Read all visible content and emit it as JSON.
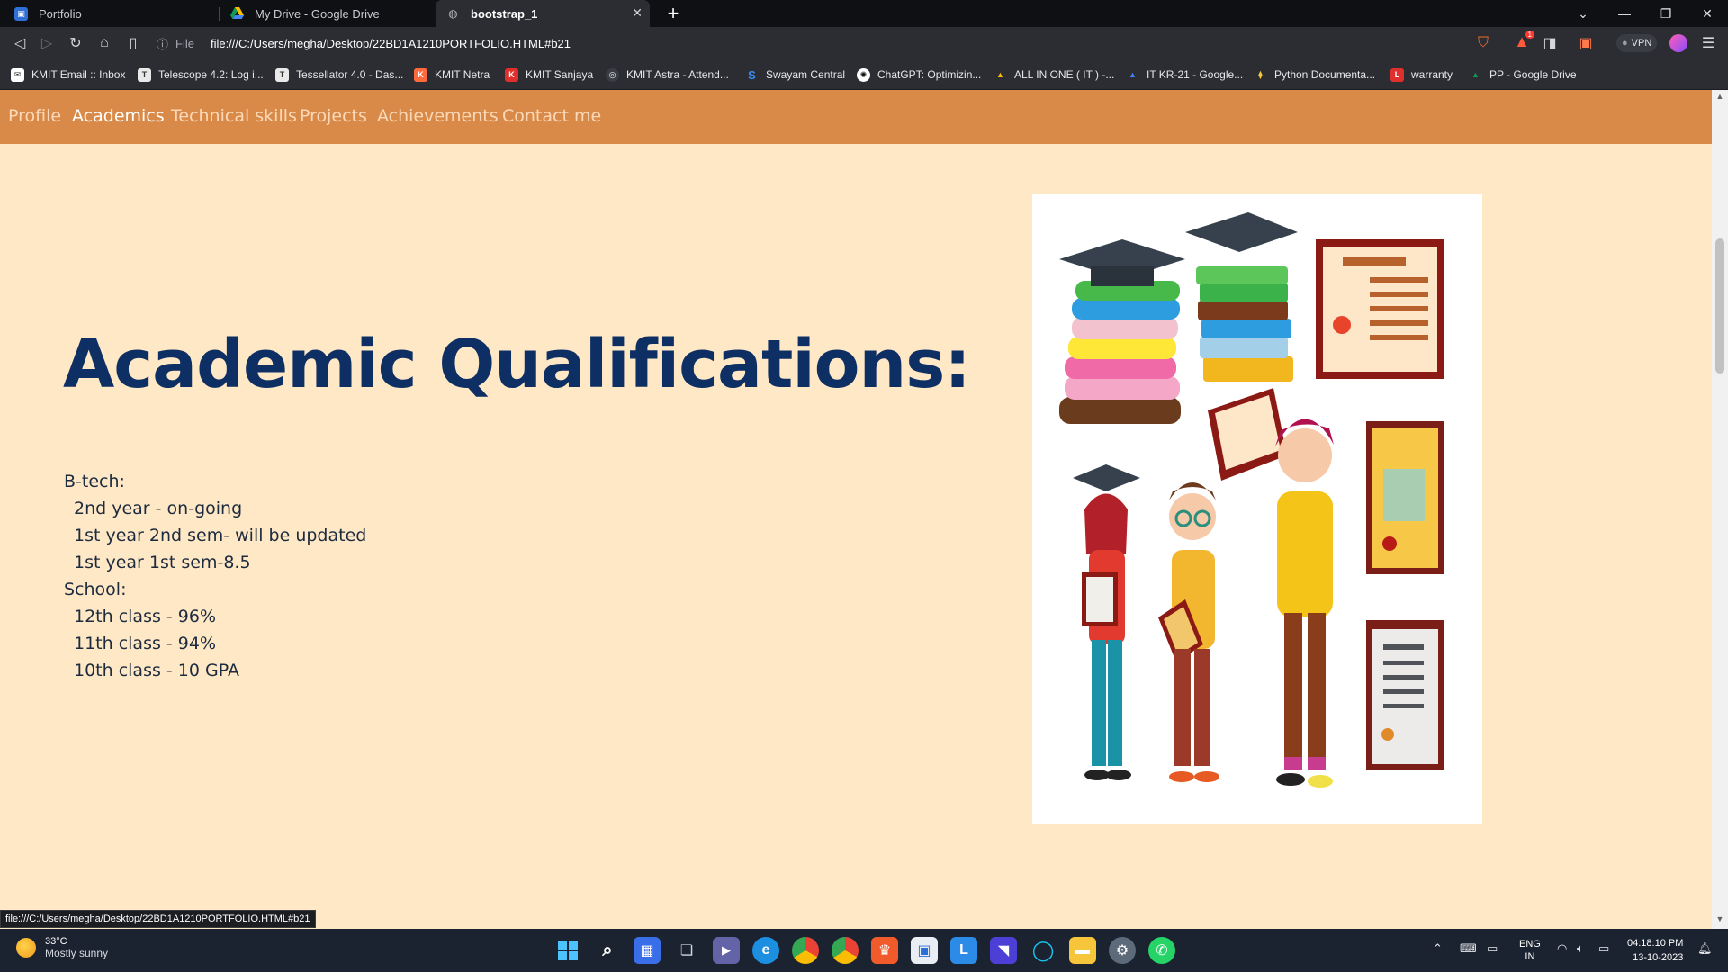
{
  "tabs": [
    {
      "title": "Portfolio",
      "icon": "portfolio-favicon"
    },
    {
      "title": "My Drive - Google Drive",
      "icon": "google-drive-favicon"
    },
    {
      "title": "bootstrap_1",
      "icon": "globe-favicon",
      "active": true
    }
  ],
  "toolbar": {
    "url_scheme": "File",
    "url": "file:///C:/Users/megha/Desktop/22BD1A1210PORTFOLIO.HTML#b21",
    "vpn_label": "VPN",
    "rewards_count": "1"
  },
  "bookmarks": [
    "KMIT Email :: Inbox",
    "Telescope 4.2: Log i...",
    "Tessellator 4.0 - Das...",
    "KMIT Netra",
    "KMIT Sanjaya",
    "KMIT Astra - Attend...",
    "Swayam Central",
    "ChatGPT: Optimizin...",
    "ALL IN ONE ( IT ) -...",
    "IT KR-21 - Google...",
    "Python Documenta...",
    "warranty",
    "PP - Google Drive"
  ],
  "nav": {
    "items": [
      "Profile",
      "Academics",
      "Technical skills",
      "Projects",
      "Achievements",
      "Contact me"
    ],
    "active": "Academics"
  },
  "academics": {
    "heading": "Academic Qualifications:",
    "lines": [
      {
        "text": "B-tech:",
        "indent": false
      },
      {
        "text": "2nd year - on-going",
        "indent": true
      },
      {
        "text": "1st year 2nd sem- will be updated",
        "indent": true
      },
      {
        "text": "1st year 1st sem-8.5",
        "indent": true
      },
      {
        "text": "School:",
        "indent": false
      },
      {
        "text": "12th class - 96%",
        "indent": true
      },
      {
        "text": "11th class - 94%",
        "indent": true
      },
      {
        "text": "10th class - 10 GPA",
        "indent": true
      }
    ]
  },
  "status_link": "file:///C:/Users/megha/Desktop/22BD1A1210PORTFOLIO.HTML#b21",
  "taskbar": {
    "weather_temp": "33°C",
    "weather_desc": "Mostly sunny",
    "lang_top": "ENG",
    "lang_bottom": "IN",
    "time": "04:18:10 PM",
    "date": "13-10-2023"
  },
  "colors": {
    "navbar": "#d98a48",
    "page_bg": "#ffe8c6",
    "heading": "#0e2f64"
  }
}
